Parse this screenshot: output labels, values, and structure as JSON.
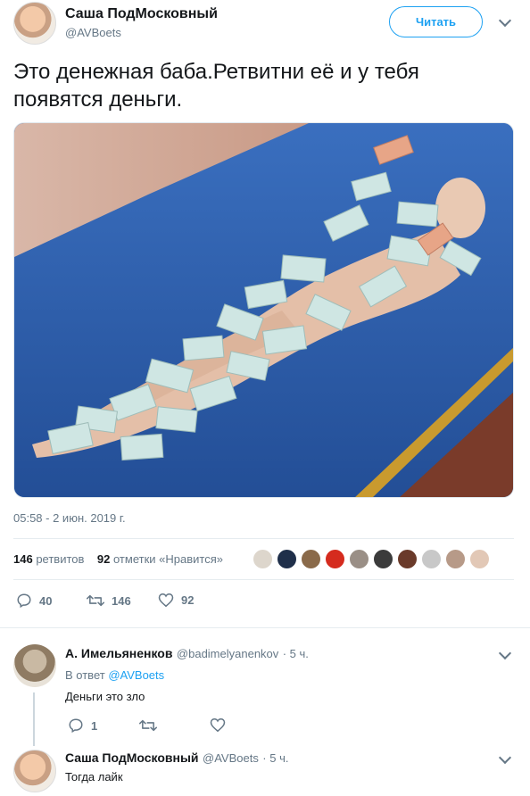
{
  "tweet": {
    "author_name": "Саша ПодМосковный",
    "author_handle": "@AVBoets",
    "follow_label": "Читать",
    "text": "Это денежная баба.Ретвитни её и у тебя появятся деньги.",
    "timestamp": "05:58 - 2 июн. 2019 г.",
    "retweets_count": "146",
    "retweets_label": "ретвитов",
    "likes_count": "92",
    "likes_label": "отметки «Нравится»",
    "actions": {
      "replies": "40",
      "retweets": "146",
      "likes": "92"
    }
  },
  "replies": [
    {
      "author_name": "А. Имельяненков",
      "author_handle": "@badimelyanenkov",
      "time": "· 5 ч.",
      "reply_to_prefix": "В ответ",
      "reply_to_handle": "@AVBoets",
      "text": "Деньги это зло",
      "actions": {
        "replies": "1",
        "retweets": "",
        "likes": ""
      }
    },
    {
      "author_name": "Саша ПодМосковный",
      "author_handle": "@AVBoets",
      "time": "· 5 ч.",
      "text": "Тогда лайк"
    }
  ],
  "icons": {
    "reply": "reply-icon",
    "retweet": "retweet-icon",
    "like": "heart-icon",
    "more": "chevron-down-icon"
  },
  "colors": {
    "accent": "#1da1f2",
    "secondary_text": "#657786",
    "primary_text": "#14171a"
  }
}
